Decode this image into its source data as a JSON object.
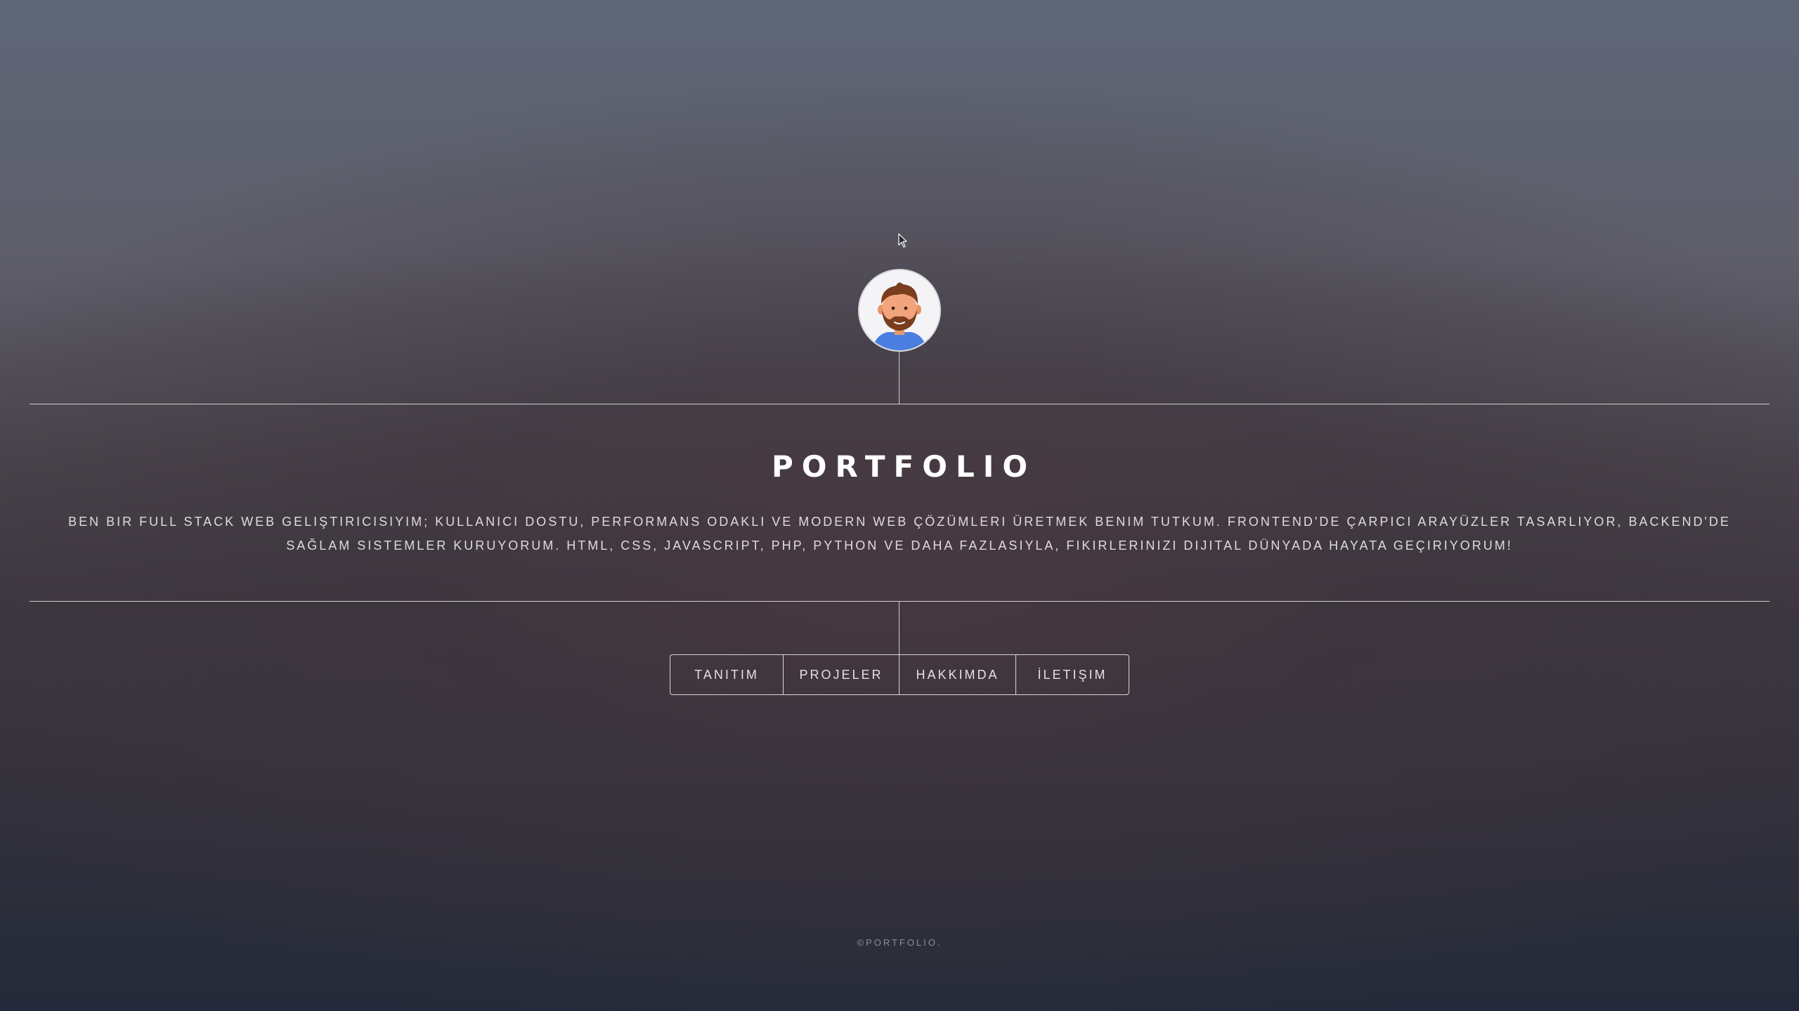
{
  "header": {
    "avatar_icon": "bearded-man-avatar-icon"
  },
  "main": {
    "title": "PORTFOLIO",
    "description": "BEN BIR FULL STACK WEB GELIŞTIRICISIYIM; KULLANICI DOSTU, PERFORMANS ODAKLI VE MODERN WEB ÇÖZÜMLERI ÜRETMEK BENIM TUTKUM. FRONTEND'DE ÇARPICI ARAYÜZLER TASARLIYOR, BACKEND'DE SAĞLAM SISTEMLER KURUYORUM. HTML, CSS, JAVASCRIPT, PHP, PYTHON VE DAHA FAZLASIYLA, FIKIRLERINIZI DIJITAL DÜNYADA HAYATA GEÇIRIYORUM!"
  },
  "nav": {
    "items": [
      {
        "label": "TANITIM"
      },
      {
        "label": "PROJELER"
      },
      {
        "label": "HAKKIMDA"
      },
      {
        "label": "İLETIŞIM"
      }
    ]
  },
  "footer": {
    "copyright": "©PORTFOLIO."
  },
  "colors": {
    "background_top": "#5e6676",
    "background_bottom": "#232a39",
    "line": "#ffffff"
  }
}
